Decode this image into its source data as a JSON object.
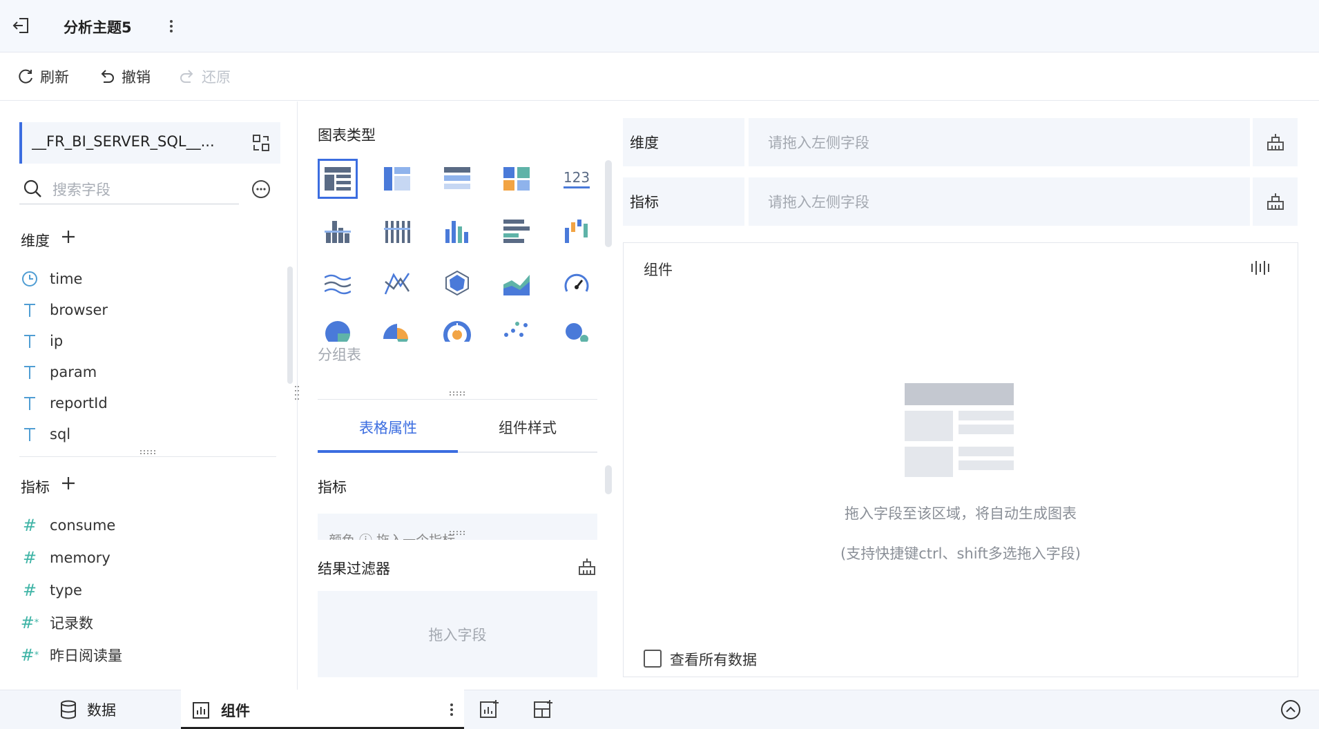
{
  "header": {
    "title": "分析主题5",
    "exit_icon": "exit-icon",
    "more_icon": "more-vertical-icon"
  },
  "toolbar": {
    "refresh_label": "刷新",
    "undo_label": "撤销",
    "redo_label": "还原"
  },
  "fields": {
    "dataset_name": "__FR_BI_SERVER_SQL__...",
    "search_placeholder": "搜索字段",
    "dimension_title": "维度",
    "dimensions": [
      {
        "label": "time",
        "icon": "clock-icon"
      },
      {
        "label": "browser",
        "icon": "text-type-icon"
      },
      {
        "label": "ip",
        "icon": "text-type-icon"
      },
      {
        "label": "param",
        "icon": "text-type-icon"
      },
      {
        "label": "reportId",
        "icon": "text-type-icon"
      },
      {
        "label": "sql",
        "icon": "text-type-icon"
      }
    ],
    "metric_title": "指标",
    "metrics": [
      {
        "label": "consume",
        "icon": "number-type-icon"
      },
      {
        "label": "memory",
        "icon": "number-type-icon"
      },
      {
        "label": "type",
        "icon": "number-type-icon"
      },
      {
        "label": "记录数",
        "icon": "calculated-number-icon"
      },
      {
        "label": "昨日阅读量",
        "icon": "calculated-number-icon"
      }
    ]
  },
  "chart_panel": {
    "title": "图表类型",
    "selected_caption": "分组表",
    "tabs": [
      "表格属性",
      "组件样式"
    ],
    "metric_label": "指标",
    "metric_row_partial": "颜色 ⓘ     拖入一个指标",
    "filter_title": "结果过滤器",
    "filter_drop": "拖入字段"
  },
  "right": {
    "dimension_label": "维度",
    "dimension_placeholder": "请拖入左侧字段",
    "metric_label": "指标",
    "metric_placeholder": "请拖入左侧字段",
    "canvas_title": "组件",
    "hint_line1": "拖入字段至该区域，将自动生成图表",
    "hint_line2": "(支持快捷键ctrl、shift多选拖入字段)",
    "checkbox_label": "查看所有数据"
  },
  "bottom": {
    "data_tab": "数据",
    "widget_tab": "组件"
  },
  "colors": {
    "accent": "#3b6de0",
    "panel_bg": "#f3f6fb",
    "field_dim": "#4f9dd3",
    "field_metric": "#3fb4a6"
  }
}
